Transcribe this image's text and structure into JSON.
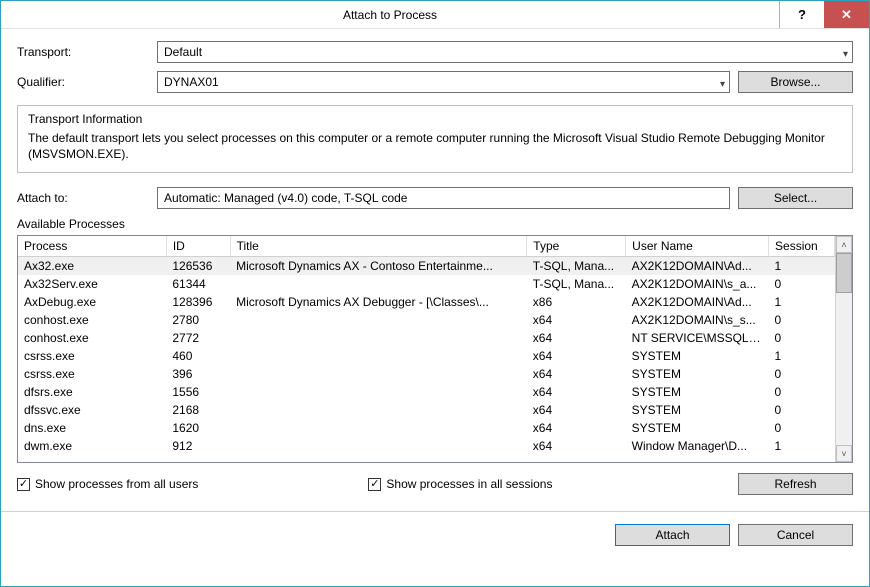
{
  "window": {
    "title": "Attach to Process"
  },
  "labels": {
    "transport": "Transport:",
    "qualifier": "Qualifier:",
    "attach_to": "Attach to:",
    "available": "Available Processes"
  },
  "transport": {
    "value": "Default"
  },
  "qualifier": {
    "value": "DYNAX01"
  },
  "buttons": {
    "browse": "Browse...",
    "select": "Select...",
    "refresh": "Refresh",
    "attach": "Attach",
    "cancel": "Cancel"
  },
  "fieldset": {
    "legend": "Transport Information",
    "body": "The default transport lets you select processes on this computer or a remote computer running the Microsoft Visual Studio Remote Debugging Monitor (MSVSMON.EXE)."
  },
  "attach_to": {
    "value": "Automatic: Managed (v4.0) code, T-SQL code"
  },
  "columns": {
    "process": "Process",
    "id": "ID",
    "title": "Title",
    "type": "Type",
    "user": "User Name",
    "session": "Session"
  },
  "rows": [
    {
      "process": "Ax32.exe",
      "id": "126536",
      "title": "Microsoft Dynamics AX - Contoso Entertainme...",
      "type": "T-SQL, Mana...",
      "user": "AX2K12DOMAIN\\Ad...",
      "session": "1",
      "selected": true
    },
    {
      "process": "Ax32Serv.exe",
      "id": "61344",
      "title": "",
      "type": "T-SQL, Mana...",
      "user": "AX2K12DOMAIN\\s_a...",
      "session": "0"
    },
    {
      "process": "AxDebug.exe",
      "id": "128396",
      "title": "Microsoft Dynamics AX Debugger  - [\\Classes\\...",
      "type": "x86",
      "user": "AX2K12DOMAIN\\Ad...",
      "session": "1"
    },
    {
      "process": "conhost.exe",
      "id": "2780",
      "title": "",
      "type": "x64",
      "user": "AX2K12DOMAIN\\s_s...",
      "session": "0"
    },
    {
      "process": "conhost.exe",
      "id": "2772",
      "title": "",
      "type": "x64",
      "user": "NT SERVICE\\MSSQLF...",
      "session": "0"
    },
    {
      "process": "csrss.exe",
      "id": "460",
      "title": "",
      "type": "x64",
      "user": "SYSTEM",
      "session": "1"
    },
    {
      "process": "csrss.exe",
      "id": "396",
      "title": "",
      "type": "x64",
      "user": "SYSTEM",
      "session": "0"
    },
    {
      "process": "dfsrs.exe",
      "id": "1556",
      "title": "",
      "type": "x64",
      "user": "SYSTEM",
      "session": "0"
    },
    {
      "process": "dfssvc.exe",
      "id": "2168",
      "title": "",
      "type": "x64",
      "user": "SYSTEM",
      "session": "0"
    },
    {
      "process": "dns.exe",
      "id": "1620",
      "title": "",
      "type": "x64",
      "user": "SYSTEM",
      "session": "0"
    },
    {
      "process": "dwm.exe",
      "id": "912",
      "title": "",
      "type": "x64",
      "user": "Window Manager\\D...",
      "session": "1"
    }
  ],
  "checks": {
    "all_users": "Show processes from all users",
    "all_sessions": "Show processes in all sessions"
  }
}
